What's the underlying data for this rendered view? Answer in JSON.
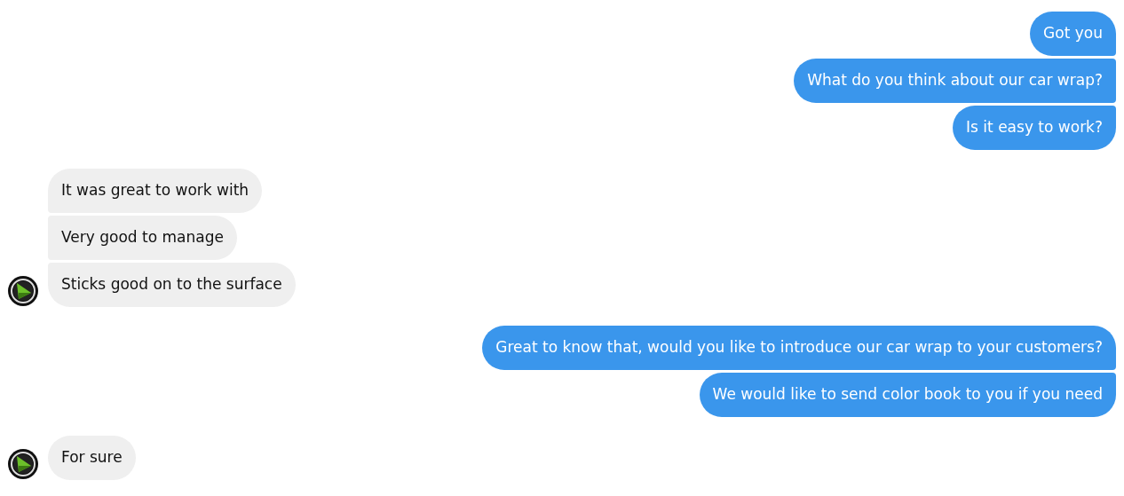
{
  "groups": [
    {
      "kind": "sent",
      "messages": [
        "Got you",
        "What do you think about our car wrap?",
        "Is it easy to work?"
      ]
    },
    {
      "kind": "received",
      "messages": [
        "It was great to work with",
        "Very good to manage",
        "Sticks good on to the surface"
      ]
    },
    {
      "kind": "sent",
      "messages": [
        "Great to know that, would you like to introduce our car wrap to your customers?",
        "We would like to send color book to you if you need"
      ]
    },
    {
      "kind": "received",
      "messages": [
        "For sure"
      ]
    }
  ]
}
